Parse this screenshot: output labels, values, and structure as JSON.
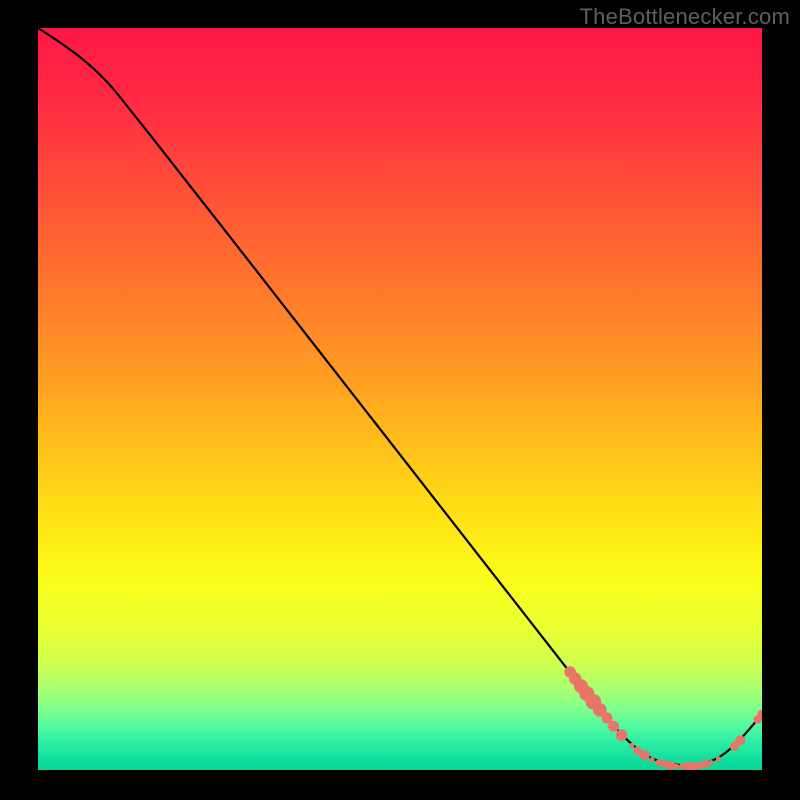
{
  "watermark": "TheBottlenecker.com",
  "gradient": {
    "stops": [
      {
        "offset": 0.0,
        "color": "#ff1846"
      },
      {
        "offset": 0.1,
        "color": "#ff2b42"
      },
      {
        "offset": 0.22,
        "color": "#ff5037"
      },
      {
        "offset": 0.34,
        "color": "#ff742d"
      },
      {
        "offset": 0.46,
        "color": "#ff9a23"
      },
      {
        "offset": 0.57,
        "color": "#ffc21a"
      },
      {
        "offset": 0.67,
        "color": "#ffe614"
      },
      {
        "offset": 0.75,
        "color": "#faff1a"
      },
      {
        "offset": 0.81,
        "color": "#e8ff32"
      },
      {
        "offset": 0.855,
        "color": "#d0ff4e"
      },
      {
        "offset": 0.89,
        "color": "#aaff70"
      },
      {
        "offset": 0.918,
        "color": "#7fff8e"
      },
      {
        "offset": 0.942,
        "color": "#50f9a0"
      },
      {
        "offset": 0.965,
        "color": "#29eca4"
      },
      {
        "offset": 0.985,
        "color": "#12df9f"
      },
      {
        "offset": 1.0,
        "color": "#04d598"
      }
    ]
  },
  "chart_data": {
    "type": "line",
    "title": "",
    "xlabel": "",
    "ylabel": "",
    "xlim": [
      0,
      1
    ],
    "ylim": [
      0,
      1
    ],
    "curve": [
      {
        "x": 0.0,
        "y": 1.0
      },
      {
        "x": 0.035,
        "y": 0.978
      },
      {
        "x": 0.07,
        "y": 0.952
      },
      {
        "x": 0.098,
        "y": 0.925
      },
      {
        "x": 0.115,
        "y": 0.905
      },
      {
        "x": 0.2,
        "y": 0.8
      },
      {
        "x": 0.3,
        "y": 0.675
      },
      {
        "x": 0.4,
        "y": 0.55
      },
      {
        "x": 0.5,
        "y": 0.425
      },
      {
        "x": 0.6,
        "y": 0.3
      },
      {
        "x": 0.7,
        "y": 0.175
      },
      {
        "x": 0.76,
        "y": 0.1
      },
      {
        "x": 0.805,
        "y": 0.048
      },
      {
        "x": 0.835,
        "y": 0.022
      },
      {
        "x": 0.86,
        "y": 0.01
      },
      {
        "x": 0.9,
        "y": 0.005
      },
      {
        "x": 0.935,
        "y": 0.012
      },
      {
        "x": 0.965,
        "y": 0.035
      },
      {
        "x": 1.0,
        "y": 0.075
      }
    ],
    "markers": [
      {
        "x": 0.735,
        "y": 0.132,
        "r": 5.8
      },
      {
        "x": 0.742,
        "y": 0.123,
        "r": 6.2
      },
      {
        "x": 0.75,
        "y": 0.113,
        "r": 7.0
      },
      {
        "x": 0.758,
        "y": 0.103,
        "r": 7.5
      },
      {
        "x": 0.767,
        "y": 0.092,
        "r": 7.8
      },
      {
        "x": 0.776,
        "y": 0.081,
        "r": 6.8
      },
      {
        "x": 0.786,
        "y": 0.07,
        "r": 5.5
      },
      {
        "x": 0.795,
        "y": 0.059,
        "r": 5.5
      },
      {
        "x": 0.806,
        "y": 0.047,
        "r": 5.8
      },
      {
        "x": 0.82,
        "y": 0.033,
        "r": 2.6
      },
      {
        "x": 0.828,
        "y": 0.026,
        "r": 4.2
      },
      {
        "x": 0.838,
        "y": 0.02,
        "r": 5.0
      },
      {
        "x": 0.848,
        "y": 0.014,
        "r": 2.6
      },
      {
        "x": 0.858,
        "y": 0.01,
        "r": 3.5
      },
      {
        "x": 0.866,
        "y": 0.008,
        "r": 4.0
      },
      {
        "x": 0.874,
        "y": 0.006,
        "r": 4.6
      },
      {
        "x": 0.882,
        "y": 0.005,
        "r": 2.6
      },
      {
        "x": 0.89,
        "y": 0.005,
        "r": 3.3
      },
      {
        "x": 0.898,
        "y": 0.005,
        "r": 4.6
      },
      {
        "x": 0.906,
        "y": 0.005,
        "r": 4.2
      },
      {
        "x": 0.914,
        "y": 0.006,
        "r": 3.9
      },
      {
        "x": 0.922,
        "y": 0.008,
        "r": 4.2
      },
      {
        "x": 0.93,
        "y": 0.01,
        "r": 2.6
      },
      {
        "x": 0.94,
        "y": 0.015,
        "r": 2.6
      },
      {
        "x": 0.962,
        "y": 0.032,
        "r": 4.6
      },
      {
        "x": 0.97,
        "y": 0.04,
        "r": 5.0
      },
      {
        "x": 0.994,
        "y": 0.068,
        "r": 4.2
      },
      {
        "x": 1.0,
        "y": 0.075,
        "r": 4.7
      }
    ],
    "marker_color": "#e77569"
  }
}
